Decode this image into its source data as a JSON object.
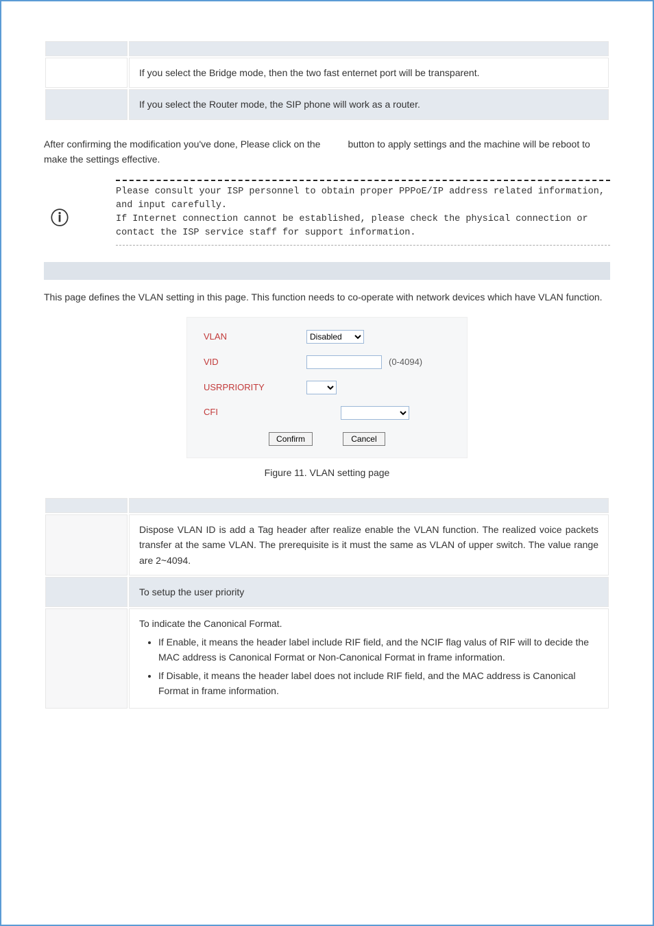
{
  "top_table": {
    "bridge_text": "If you select the Bridge mode, then the two fast enternet port will be transparent.",
    "router_text": "If you select the Router mode, the SIP phone will work as a router."
  },
  "para_after": {
    "part1": "After confirming the modification you've done, Please click on the",
    "part2": "button to apply settings and the machine will be reboot to make the settings effective."
  },
  "note_icon_glyph": "ⓘ",
  "note_text": "Please consult your ISP personnel to obtain proper PPPoE/IP address related information, and input carefully.\nIf Internet connection cannot be established, please check the physical connection or contact the ISP service staff for support information.",
  "vlan_intro": "This page defines the VLAN setting in this page. This function needs to co-operate with network devices which have VLAN function.",
  "vlan_panel": {
    "vlan_label": "VLAN",
    "vlan_value": "Disabled",
    "vid_label": "VID",
    "vid_value": "",
    "vid_range": "(0-4094)",
    "usrpriority_label": "USRPRIORITY",
    "usrpriority_value": "",
    "cfi_label": "CFI",
    "cfi_value": "",
    "confirm_label": "Confirm",
    "cancel_label": "Cancel"
  },
  "caption": "Figure 11. VLAN setting page",
  "spec_table": {
    "vid_text": "Dispose VLAN ID is add a Tag header after realize enable the VLAN function. The realized voice packets transfer at the same VLAN. The prerequisite is it must the same as VLAN of upper switch. The value range are 2~4094.",
    "usr_text": "To setup the user priority",
    "cfi_intro": "To indicate the Canonical Format.",
    "cfi_b1": "If Enable, it means the header label include RIF field, and the NCIF flag valus of RIF will to decide the MAC address is Canonical Format or Non-Canonical Format in frame information.",
    "cfi_b2": "If Disable, it means the header label does not include RIF field, and the MAC address is Canonical Format in frame information."
  }
}
